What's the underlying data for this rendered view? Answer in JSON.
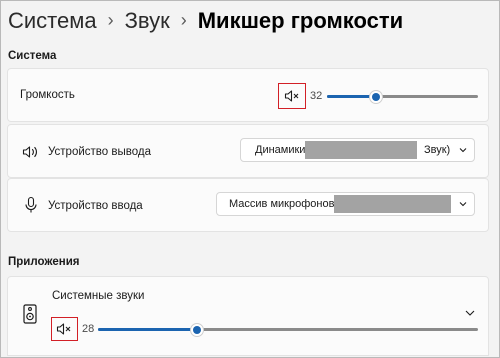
{
  "breadcrumb": {
    "items": [
      "Система",
      "Звук"
    ],
    "separator": "›",
    "current": "Микшер громкости"
  },
  "sections": {
    "system": "Система",
    "apps": "Приложения"
  },
  "volume_row": {
    "label": "Громкость",
    "icon": "speaker-muted-icon",
    "value": "32",
    "level": 0.32
  },
  "output_row": {
    "label": "Устройство вывода",
    "icon": "speaker-icon",
    "dropdown_text_left": "Динамики",
    "dropdown_text_right": "Звук)"
  },
  "input_row": {
    "label": "Устройство ввода",
    "icon": "microphone-icon",
    "dropdown_text": "Массив микрофонов"
  },
  "app_row": {
    "label": "Системные звуки",
    "icon": "system-sounds-speaker-icon",
    "mute_icon": "speaker-muted-icon",
    "value": "28",
    "level": 0.28
  },
  "colors": {
    "accent": "#1b64b0",
    "highlight_box": "#d21f26",
    "background": "#f3f3f3",
    "card": "#fbfbfb"
  }
}
